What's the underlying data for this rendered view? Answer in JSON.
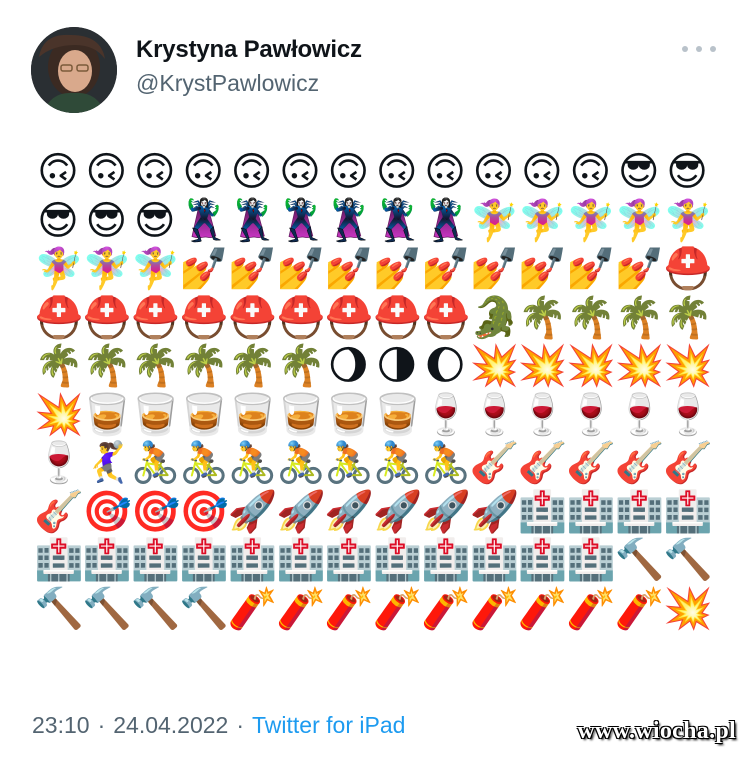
{
  "author": {
    "name": "Krystyna Pawłowicz",
    "handle": "@KrystPawlowicz"
  },
  "more_icon": "ellipsis-icon",
  "emojis": [
    "🙃",
    "🙃",
    "🙃",
    "🙃",
    "🙃",
    "🙃",
    "🙃",
    "🙃",
    "🙃",
    "🙃",
    "🙃",
    "🙃",
    "😎",
    "😎",
    "😎",
    "😎",
    "😎",
    "🦹‍♀️",
    "🦹‍♀️",
    "🦹‍♀️",
    "🦹‍♀️",
    "🦹‍♀️",
    "🦹‍♀️",
    "🧚‍♀️",
    "🧚‍♀️",
    "🧚‍♀️",
    "🧚‍♀️",
    "🧚‍♀️",
    "🧚‍♀️",
    "🧚‍♀️",
    "🧚‍♀️",
    "💅",
    "💅",
    "💅",
    "💅",
    "💅",
    "💅",
    "💅",
    "💅",
    "💅",
    "💅",
    "⛑️",
    "⛑️",
    "⛑️",
    "⛑️",
    "⛑️",
    "⛑️",
    "⛑️",
    "⛑️",
    "⛑️",
    "⛑️",
    "🐊",
    "🌴",
    "🌴",
    "🌴",
    "🌴",
    "🌴",
    "🌴",
    "🌴",
    "🌴",
    "🌴",
    "🌴",
    "🌖",
    "🌗",
    "🌔",
    "💥",
    "💥",
    "💥",
    "💥",
    "💥",
    "💥",
    "🥃",
    "🥃",
    "🥃",
    "🥃",
    "🥃",
    "🥃",
    "🥃",
    "🍷",
    "🍷",
    "🍷",
    "🍷",
    "🍷",
    "🍷",
    "🍷",
    "🤾‍♀️",
    "🚴",
    "🚴",
    "🚴",
    "🚴",
    "🚴",
    "🚴",
    "🚴",
    "🎸",
    "🎸",
    "🎸",
    "🎸",
    "🎸",
    "🎸",
    "🎯",
    "🎯",
    "🎯",
    "🚀",
    "🚀",
    "🚀",
    "🚀",
    "🚀",
    "🚀",
    "🏥",
    "🏥",
    "🏥",
    "🏥",
    "🏥",
    "🏥",
    "🏥",
    "🏥",
    "🏥",
    "🏥",
    "🏥",
    "🏥",
    "🏥",
    "🏥",
    "🏥",
    "🏥",
    "🔨",
    "🔨",
    "🔨",
    "🔨",
    "🔨",
    "🔨",
    "🧨",
    "🧨",
    "🧨",
    "🧨",
    "🧨",
    "🧨",
    "🧨",
    "🧨",
    "🧨",
    "💥"
  ],
  "footer": {
    "time": "23:10",
    "separator": "·",
    "date": "24.04.2022",
    "source": "Twitter for iPad"
  },
  "watermark": "www.wiocha.pl"
}
